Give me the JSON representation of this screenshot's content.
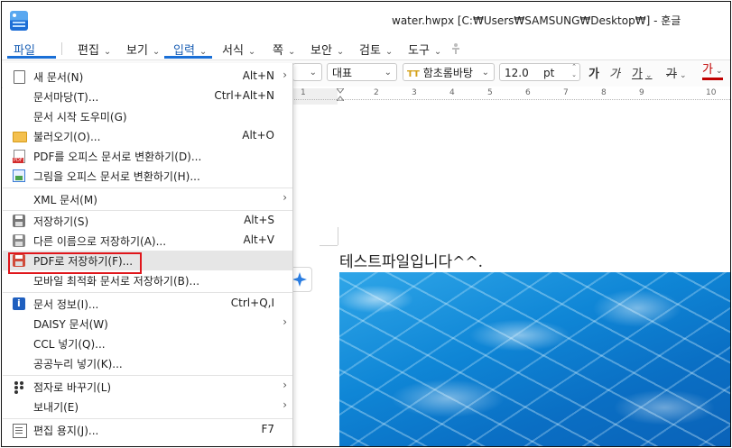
{
  "window": {
    "title": "water.hwpx [C:₩Users₩SAMSUNG₩Desktop₩] - 훈글"
  },
  "menubar": {
    "file": "파일",
    "items": [
      {
        "label": "편집",
        "chevron": "⌄"
      },
      {
        "label": "보기",
        "chevron": "⌄"
      },
      {
        "label": "입력",
        "chevron": "⌄"
      },
      {
        "label": "서식",
        "chevron": "⌄"
      },
      {
        "label": "쪽",
        "chevron": "⌄"
      },
      {
        "label": "보안",
        "chevron": "⌄"
      },
      {
        "label": "검토",
        "chevron": "⌄"
      },
      {
        "label": "도구",
        "chevron": "⌄"
      }
    ]
  },
  "toolbar": {
    "style_value": "대표",
    "font_value": "함초롬바탕",
    "font_icon": "TT",
    "size_value": "12.0",
    "size_unit": "pt",
    "bold": "가",
    "italic": "가",
    "underline": "가",
    "strike": "가",
    "color": "가"
  },
  "ruler": {
    "numbers": [
      "1",
      "2",
      "3",
      "4",
      "5",
      "6",
      "7",
      "8",
      "9",
      "10"
    ]
  },
  "document": {
    "text": "테스트파일입니다^^."
  },
  "file_menu": {
    "items": [
      {
        "label": "새 문서(N)",
        "shortcut": "Alt+N",
        "submenu": true,
        "icon": "new-document-icon"
      },
      {
        "label": "문서마당(T)...",
        "shortcut": "Ctrl+Alt+N",
        "submenu": false,
        "icon": ""
      },
      {
        "label": "문서 시작 도우미(G)",
        "shortcut": "",
        "submenu": false,
        "icon": ""
      },
      {
        "label": "불러오기(O)...",
        "shortcut": "Alt+O",
        "submenu": false,
        "icon": "open-folder-icon"
      },
      {
        "label": "PDF를 오피스 문서로 변환하기(D)...",
        "shortcut": "",
        "submenu": false,
        "icon": "pdf-convert-icon"
      },
      {
        "label": "그림을 오피스 문서로 변환하기(H)...",
        "shortcut": "",
        "submenu": false,
        "icon": "image-convert-icon"
      },
      {
        "label": "XML 문서(M)",
        "shortcut": "",
        "submenu": true,
        "icon": ""
      },
      {
        "label": "저장하기(S)",
        "shortcut": "Alt+S",
        "submenu": false,
        "icon": "save-icon"
      },
      {
        "label": "다른 이름으로 저장하기(A)...",
        "shortcut": "Alt+V",
        "submenu": false,
        "icon": "save-as-icon"
      },
      {
        "label": "PDF로 저장하기(F)...",
        "shortcut": "",
        "submenu": false,
        "icon": "save-pdf-icon"
      },
      {
        "label": "모바일 최적화 문서로 저장하기(B)...",
        "shortcut": "",
        "submenu": false,
        "icon": ""
      },
      {
        "label": "문서 정보(I)...",
        "shortcut": "Ctrl+Q,I",
        "submenu": false,
        "icon": "document-info-icon"
      },
      {
        "label": "DAISY 문서(W)",
        "shortcut": "",
        "submenu": true,
        "icon": ""
      },
      {
        "label": "CCL 넣기(Q)...",
        "shortcut": "",
        "submenu": false,
        "icon": ""
      },
      {
        "label": "공공누리 넣기(K)...",
        "shortcut": "",
        "submenu": false,
        "icon": ""
      },
      {
        "label": "점자로 바꾸기(L)",
        "shortcut": "",
        "submenu": true,
        "icon": "braille-icon"
      },
      {
        "label": "보내기(E)",
        "shortcut": "",
        "submenu": true,
        "icon": ""
      },
      {
        "label": "편집 용지(J)...",
        "shortcut": "F7",
        "submenu": false,
        "icon": "page-setup-icon"
      }
    ],
    "submenu_glyph": "›",
    "highlighted_item": "PDF로 저장하기(F)..."
  },
  "colors": {
    "accent": "#1a6fd6",
    "highlight_box": "#e0161b",
    "menu_hover": "#e6e6e6",
    "font_color_bar": "#c00000"
  }
}
